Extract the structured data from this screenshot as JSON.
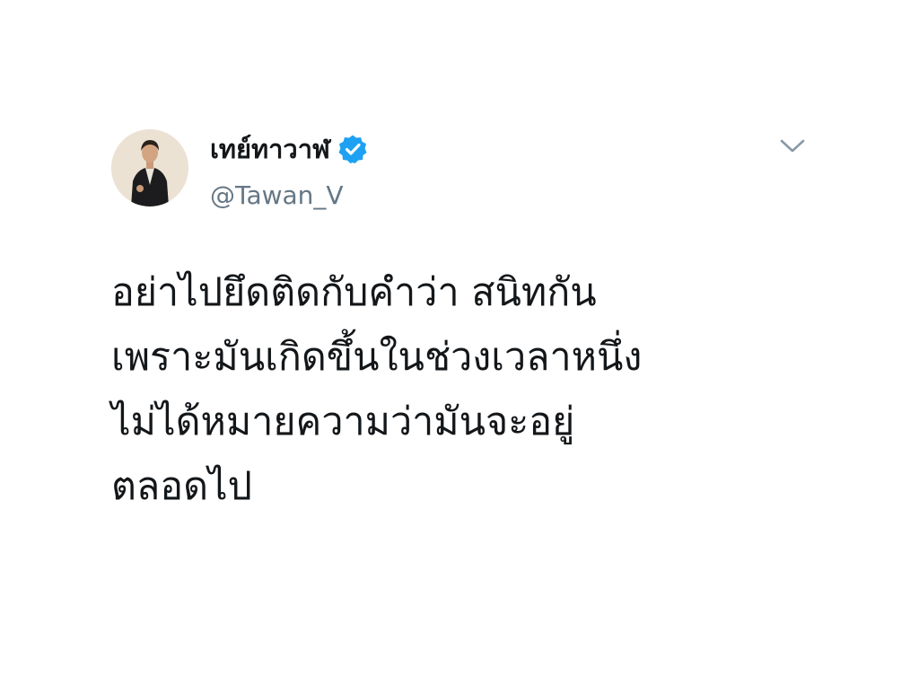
{
  "user": {
    "display_name": "เทย์ทาวาฬ",
    "handle": "@Tawan_V",
    "verified": true,
    "verified_color": "#1da1f2"
  },
  "menu": {
    "icon": "chevron-down-icon",
    "color": "#8899a6"
  },
  "tweet": {
    "lines": [
      "อย่าไปยึดติดกับคำว่า สนิทกัน",
      "เพราะมันเกิดขึ้นในช่วงเวลาหนึ่ง",
      "ไม่ได้หมายความว่ามันจะอยู่",
      "ตลอดไป"
    ]
  }
}
